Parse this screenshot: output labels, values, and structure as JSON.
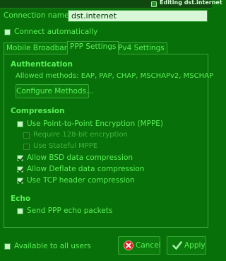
{
  "window": {
    "title": "Editing dst.internet"
  },
  "connection": {
    "name_label": "Connection name:",
    "name_value": "dst.internet",
    "auto_connect_label": "Connect automatically",
    "auto_connect_checked": false
  },
  "tabs": [
    {
      "label": "Mobile Broadband",
      "active": false
    },
    {
      "label": "PPP Settings",
      "active": true
    },
    {
      "label": "IPv4 Settings",
      "active": false
    }
  ],
  "authentication": {
    "heading": "Authentication",
    "allowed_methods_text": "Allowed methods:  EAP, PAP, CHAP, MSCHAPv2, MSCHAP",
    "configure_button_label": "Configure Methods..."
  },
  "compression": {
    "heading": "Compression",
    "options": [
      {
        "label": "Use Point-to-Point Encryption (MPPE)",
        "checked": false,
        "enabled": true
      },
      {
        "label": "Require 128-bit encryption",
        "checked": false,
        "enabled": false
      },
      {
        "label": "Use Stateful MPPE",
        "checked": false,
        "enabled": false
      },
      {
        "label": "Allow BSD data compression",
        "checked": true,
        "enabled": true
      },
      {
        "label": "Allow Deflate data compression",
        "checked": true,
        "enabled": true
      },
      {
        "label": "Use TCP header compression",
        "checked": true,
        "enabled": true
      }
    ]
  },
  "echo": {
    "heading": "Echo",
    "send_echo_label": "Send PPP echo packets",
    "send_echo_checked": false
  },
  "footer": {
    "available_to_all_label": "Available to all users",
    "available_to_all_checked": false,
    "cancel_label": "Cancel",
    "apply_label": "Apply"
  },
  "icons": {
    "window": "network-icon",
    "cancel": "cancel-icon",
    "apply": "checkmark-icon"
  },
  "colors": {
    "background": "#087008",
    "text": "#58f058",
    "entry_background": "#d7f7d7",
    "cancel_icon": "#e02020"
  }
}
